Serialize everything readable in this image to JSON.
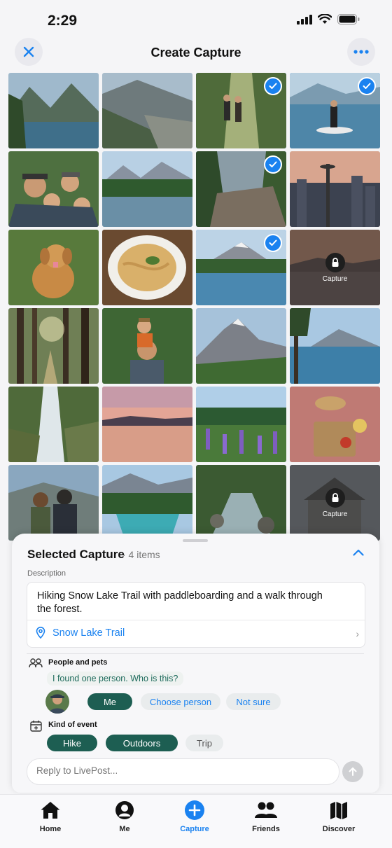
{
  "status": {
    "time": "2:29"
  },
  "nav": {
    "title": "Create Capture"
  },
  "grid": {
    "locked_label": "Capture",
    "tiles": [
      {
        "kind": "lake-mountain",
        "selected": false
      },
      {
        "kind": "valley",
        "selected": false
      },
      {
        "kind": "hikers",
        "selected": true
      },
      {
        "kind": "paddleboard",
        "selected": true
      },
      {
        "kind": "family-selfie",
        "selected": false
      },
      {
        "kind": "mountain-lake",
        "selected": false
      },
      {
        "kind": "rocky-trail",
        "selected": true
      },
      {
        "kind": "city-needle",
        "selected": false
      },
      {
        "kind": "dog",
        "selected": false
      },
      {
        "kind": "pasta",
        "selected": false
      },
      {
        "kind": "mountain-lake-2",
        "selected": true
      },
      {
        "kind": "sunset-lake",
        "selected": false,
        "locked": true
      },
      {
        "kind": "forest",
        "selected": false
      },
      {
        "kind": "dad-kid",
        "selected": false
      },
      {
        "kind": "peak",
        "selected": false
      },
      {
        "kind": "lake-pine",
        "selected": false
      },
      {
        "kind": "waterfall",
        "selected": false
      },
      {
        "kind": "pink-lake",
        "selected": false
      },
      {
        "kind": "lupine",
        "selected": false
      },
      {
        "kind": "picnic",
        "selected": false
      },
      {
        "kind": "couple",
        "selected": false
      },
      {
        "kind": "turquoise-lake",
        "selected": false
      },
      {
        "kind": "creek",
        "selected": false
      },
      {
        "kind": "house",
        "selected": false,
        "locked": true
      }
    ]
  },
  "sheet": {
    "title": "Selected Capture",
    "count": "· 4 items",
    "description_label": "Description",
    "description": "Hiking Snow Lake Trail with paddleboarding and a walk through the forest.",
    "location": "Snow Lake Trail",
    "people_label": "People and pets",
    "question": "I found one person. Who is this?",
    "person_chips": [
      {
        "label": "Me",
        "selected": true
      },
      {
        "label": "Choose person",
        "selected": false
      },
      {
        "label": "Not sure",
        "selected": false
      }
    ],
    "event_label": "Kind of event",
    "event_chips": [
      {
        "label": "Hike",
        "selected": true
      },
      {
        "label": "Outdoors",
        "selected": true
      },
      {
        "label": "Trip",
        "selected": false
      }
    ],
    "reply_placeholder": "Reply to LivePost..."
  },
  "tabs": [
    {
      "label": "Home",
      "icon": "home-icon",
      "active": false
    },
    {
      "label": "Me",
      "icon": "person-icon",
      "active": false
    },
    {
      "label": "Capture",
      "icon": "plus-icon",
      "active": true
    },
    {
      "label": "Friends",
      "icon": "friends-icon",
      "active": false
    },
    {
      "label": "Discover",
      "icon": "map-icon",
      "active": false
    }
  ],
  "colors": {
    "accent": "#1a82f0",
    "chip_selected": "#1d5e52"
  }
}
